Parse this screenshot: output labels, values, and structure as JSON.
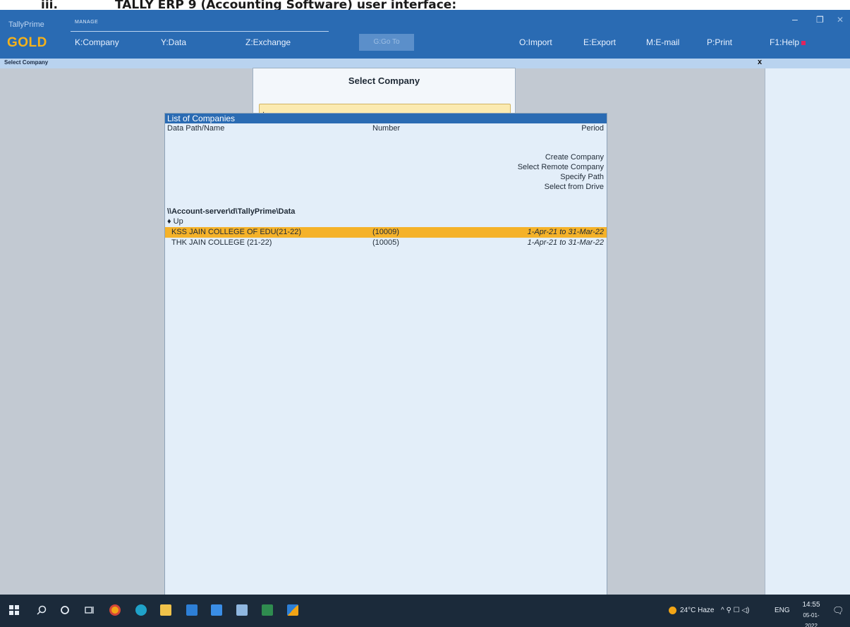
{
  "document": {
    "numeral": "iii.",
    "heading": "TALLY ERP 9 (Accounting Software) user interface:"
  },
  "app": {
    "brand_top": "TallyPrime",
    "brand_gold": "GOLD",
    "manage_label": "MANAGE",
    "menu": {
      "company": "K:Company",
      "data": "Y:Data",
      "exchange": "Z:Exchange",
      "goto": "G:Go To",
      "import": "O:Import",
      "export": "E:Export",
      "email": "M:E-mail",
      "print": "P:Print",
      "help": "F1:Help"
    },
    "window_controls": {
      "minimize": "–",
      "maximize": "❐",
      "close": "✕"
    },
    "screen_title": "Select Company",
    "close_mark": "x"
  },
  "select_company": {
    "title": "Select Company",
    "input_value": ","
  },
  "list": {
    "header": "List of Companies",
    "columns": {
      "name": "Data Path/Name",
      "number": "Number",
      "period": "Period"
    },
    "actions": [
      "Create Company",
      "Select Remote Company",
      "Specify Path",
      "Select from Drive"
    ],
    "path": "\\\\Account-server\\d\\TallyPrime\\Data",
    "up_label": "♦ Up",
    "companies": [
      {
        "name": "KSS JAIN COLLEGE OF EDU(21-22)",
        "number": "(10009)",
        "period": "1-Apr-21 to 31-Mar-22",
        "selected": true
      },
      {
        "name": "THK JAIN COLLEGE (21-22)",
        "number": "(10005)",
        "period": "1-Apr-21 to 31-Mar-22",
        "selected": false
      }
    ]
  },
  "taskbar": {
    "icons": [
      "windows-start-icon",
      "search-icon",
      "cortana-icon",
      "task-view-icon",
      "chrome-icon",
      "edge-icon",
      "file-explorer-icon",
      "calendar-icon",
      "mail-icon",
      "app-icon",
      "excel-icon",
      "tally-icon"
    ],
    "weather": "24°C Haze",
    "tray_icons": "^ ⚲ ☐ ◁)",
    "language": "ENG",
    "time": "14:55",
    "date": "05-01-2022",
    "notification": "🗨"
  },
  "colors": {
    "accent_blue": "#2a6bb3",
    "gold": "#f5b21a",
    "selected_row": "#f5b229",
    "input_bg": "#fbeab0"
  }
}
